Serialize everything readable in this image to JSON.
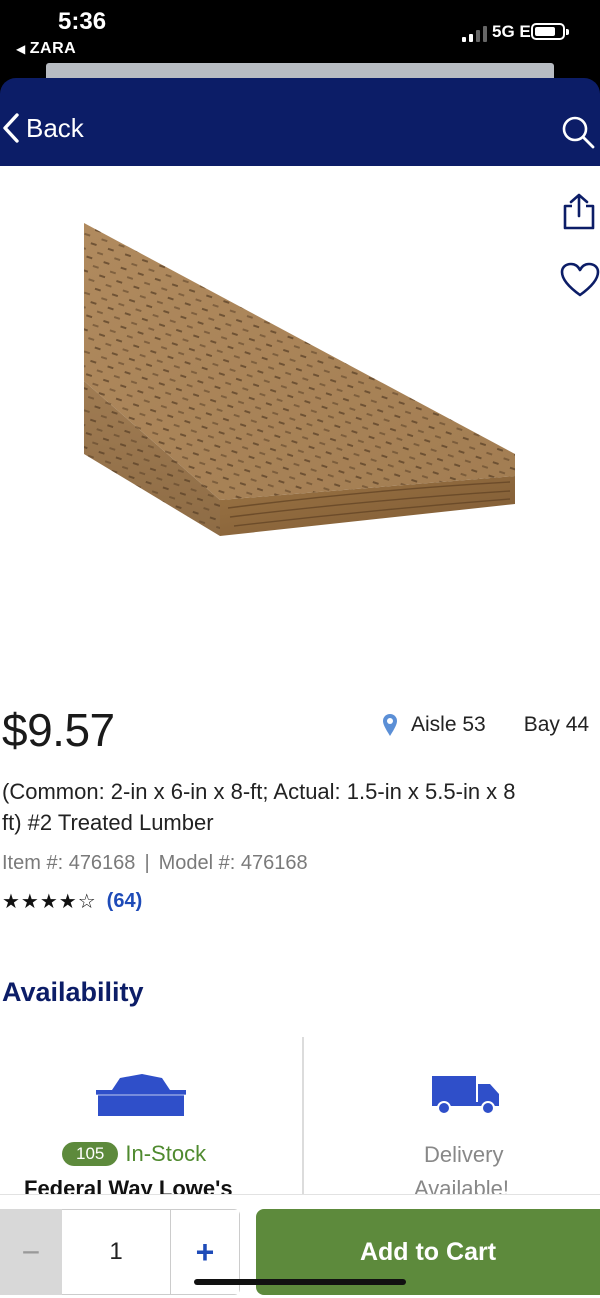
{
  "status_bar": {
    "time": "5:36",
    "back_app": "ZARA",
    "network": "5G E"
  },
  "nav": {
    "back_label": "Back",
    "search_icon": "search-icon"
  },
  "product": {
    "image": "treated-lumber-board",
    "price": "$9.57",
    "aisle": "Aisle 53",
    "bay": "Bay 44",
    "title_line1": "(Common: 2-in x 6-in x 8-ft; Actual: 1.5-in x 5.5-in x 8",
    "title_line2": "ft) #2 Treated Lumber",
    "item_number": "Item #: 476168",
    "separator": "|",
    "model_number": "Model #: 476168",
    "rating_stars": 4.5,
    "rating_display": "★★★★☆",
    "review_count": "(64)"
  },
  "availability": {
    "heading": "Availability",
    "pickup": {
      "stock_count": "105",
      "stock_label": "In-Stock",
      "store_name": "Federal Way Lowe's"
    },
    "delivery": {
      "label_line1": "Delivery",
      "label_line2": "Available!"
    }
  },
  "cart_bar": {
    "minus": "−",
    "quantity": "1",
    "plus": "+",
    "add_to_cart": "Add to Cart"
  },
  "colors": {
    "nav_bg": "#0c1d67",
    "accent_green": "#5d8a3c",
    "link_blue": "#1e4bb8",
    "icon_blue": "#2f4fc9"
  }
}
